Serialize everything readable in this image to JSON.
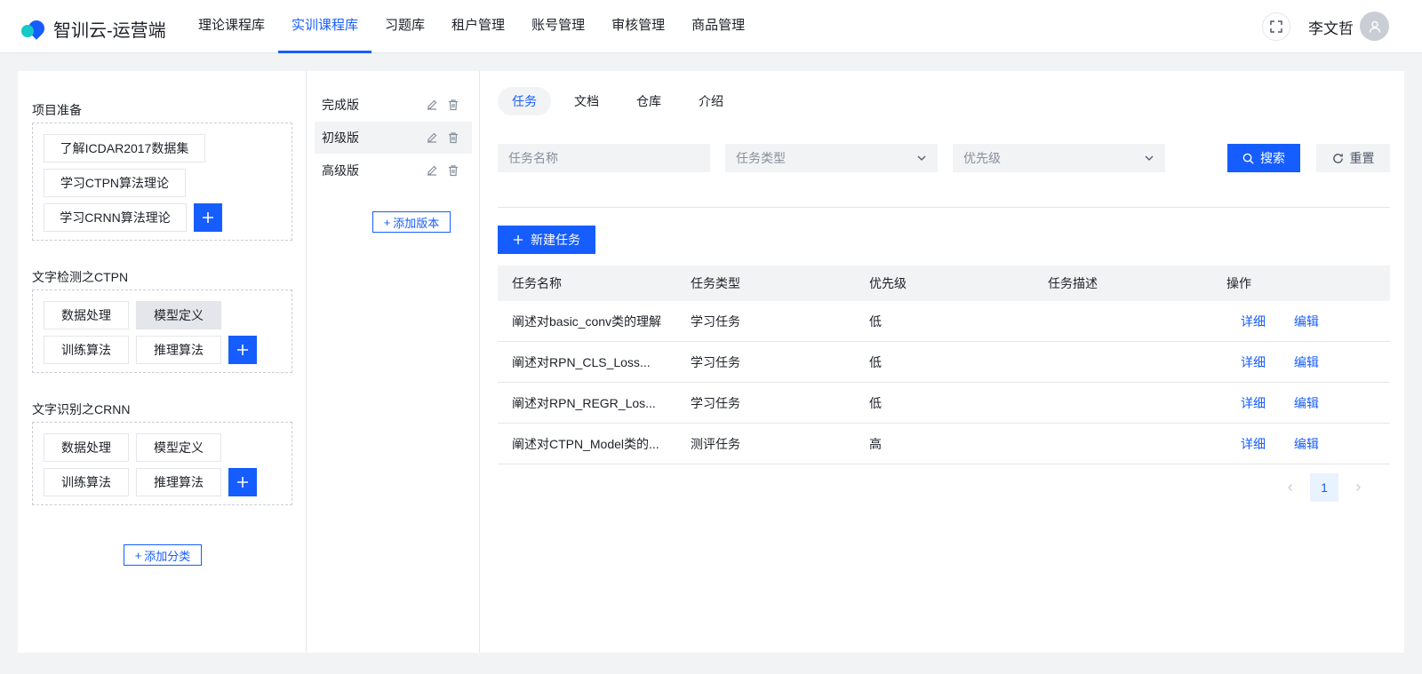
{
  "app": {
    "title": "智训云-运营端"
  },
  "nav": {
    "items": [
      {
        "label": "理论课程库"
      },
      {
        "label": "实训课程库"
      },
      {
        "label": "习题库"
      },
      {
        "label": "租户管理"
      },
      {
        "label": "账号管理"
      },
      {
        "label": "审核管理"
      },
      {
        "label": "商品管理"
      }
    ],
    "active": "实训课程库"
  },
  "user": {
    "name": "李文哲"
  },
  "categories": [
    {
      "title": "项目准备",
      "items": [
        "了解ICDAR2017数据集",
        "学习CTPN算法理论",
        "学习CRNN算法理论"
      ]
    },
    {
      "title": "文字检测之CTPN",
      "items": [
        "数据处理",
        "模型定义",
        "训练算法",
        "推理算法"
      ],
      "selected": "模型定义"
    },
    {
      "title": "文字识别之CRNN",
      "items": [
        "数据处理",
        "模型定义",
        "训练算法",
        "推理算法"
      ]
    }
  ],
  "add_category_label": "添加分类",
  "versions": {
    "items": [
      "完成版",
      "初级版",
      "高级版"
    ],
    "selected": "初级版",
    "add_label": "添加版本"
  },
  "tabs": [
    "任务",
    "文档",
    "仓库",
    "介绍"
  ],
  "active_tab": "任务",
  "filters": {
    "name_placeholder": "任务名称",
    "type_placeholder": "任务类型",
    "priority_placeholder": "优先级",
    "search_label": "搜索",
    "reset_label": "重置"
  },
  "new_task_label": "新建任务",
  "table": {
    "columns": [
      "任务名称",
      "任务类型",
      "优先级",
      "任务描述",
      "操作"
    ],
    "rows": [
      {
        "name": "阐述对basic_conv类的理解",
        "type": "学习任务",
        "priority": "低",
        "desc": ""
      },
      {
        "name": "阐述对RPN_CLS_Loss...",
        "type": "学习任务",
        "priority": "低",
        "desc": ""
      },
      {
        "name": "阐述对RPN_REGR_Los...",
        "type": "学习任务",
        "priority": "低",
        "desc": ""
      },
      {
        "name": "阐述对CTPN_Model类的...",
        "type": "测评任务",
        "priority": "高",
        "desc": ""
      }
    ],
    "actions": {
      "detail": "详细",
      "edit": "编辑"
    }
  },
  "pagination": {
    "current": "1"
  },
  "colors": {
    "primary": "#165dff",
    "bg": "#f2f3f5",
    "text": "#1d2129"
  }
}
